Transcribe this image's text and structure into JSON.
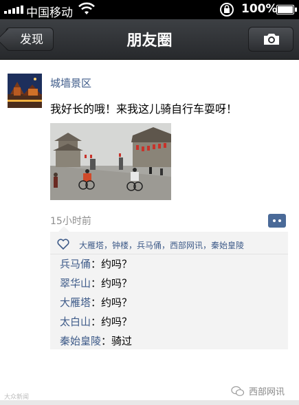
{
  "status_bar": {
    "carrier": "中国移动",
    "battery_text": "100%",
    "battery_level": 1.0,
    "signal_bars": 5
  },
  "nav": {
    "back_label": "发现",
    "title": "朋友圈",
    "camera_icon": "camera-icon"
  },
  "post": {
    "username": "城墙景区",
    "text": "我好长的哦！来我这儿骑自行车耍呀！",
    "timestamp": "15小时前",
    "likes": "大雁塔，钟楼，兵马俑，西部网讯，秦始皇陵",
    "comments": [
      {
        "author": "兵马俑",
        "sep": "：",
        "text": "约吗？"
      },
      {
        "author": "翠华山",
        "sep": "：",
        "text": "约吗？"
      },
      {
        "author": "大雁塔",
        "sep": "：",
        "text": "约吗？"
      },
      {
        "author": "太白山",
        "sep": "：",
        "text": "约吗？"
      },
      {
        "author": "秦始皇陵",
        "sep": "：",
        "text": "骑过"
      }
    ]
  },
  "watermark": {
    "left_text": "大众新闻",
    "right_text": "西部网讯"
  },
  "colors": {
    "link_blue": "#3d5a88",
    "nav_bg": "#2e3034",
    "comment_bg": "#f3f3f3"
  }
}
